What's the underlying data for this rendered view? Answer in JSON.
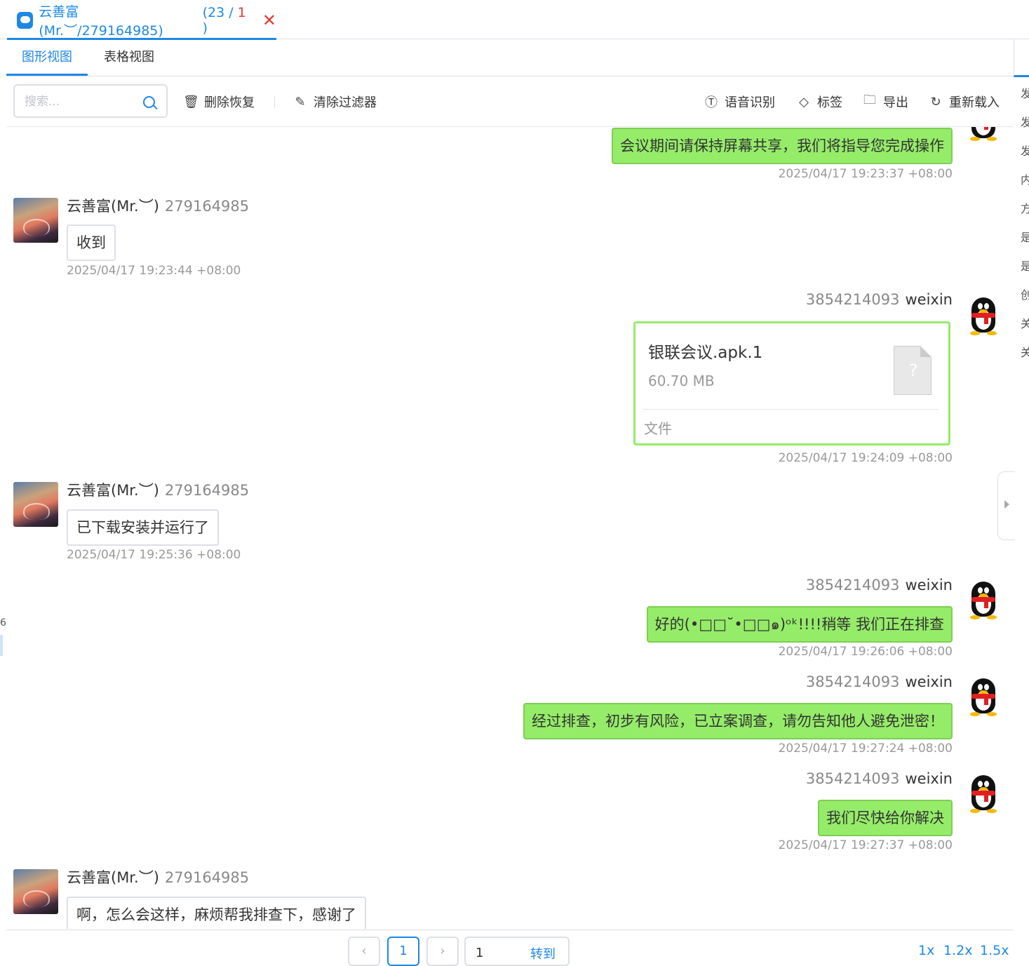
{
  "window_tab": {
    "title": "云善富(Mr.︶/279164985)",
    "count_prefix": "(23 / ",
    "count_red": "1",
    "count_suffix": " )",
    "close_icon": "close-icon"
  },
  "view_tabs": {
    "graph": "图形视图",
    "table": "表格视图"
  },
  "toolbar": {
    "search_placeholder": "搜索...",
    "delete_recover": "删除恢复",
    "clear_filter": "清除过滤器",
    "speech_recognition": "语音识别",
    "tag": "标签",
    "export": "导出",
    "reload": "重新载入"
  },
  "messages": [
    {
      "direction": "out",
      "text": "会议期间请保持屏幕共享，我们将指导您完成操作",
      "time": "2025/04/17 19:23:37 +08:00"
    },
    {
      "direction": "in",
      "sender_name": "云善富(Mr.︶)",
      "sender_id": "279164985",
      "text": "收到",
      "time": "2025/04/17 19:23:44 +08:00"
    },
    {
      "direction": "out",
      "sender_id": "3854214093",
      "sender_name": "weixin",
      "type": "file",
      "file_name": "银联会议.apk.1",
      "file_size": "60.70 MB",
      "file_type": "文件",
      "time": "2025/04/17 19:24:09 +08:00"
    },
    {
      "direction": "in",
      "sender_name": "云善富(Mr.︶)",
      "sender_id": "279164985",
      "text": "已下载安装并运行了",
      "time": "2025/04/17 19:25:36 +08:00"
    },
    {
      "direction": "out",
      "sender_id": "3854214093",
      "sender_name": "weixin",
      "text": "好的(•□□˘•□□๑)ᵒᵏ!!!!稍等 我们正在排查",
      "time": "2025/04/17 19:26:06 +08:00"
    },
    {
      "direction": "out",
      "sender_id": "3854214093",
      "sender_name": "weixin",
      "text": "经过排查，初步有风险，已立案调查，请勿告知他人避免泄密！",
      "time": "2025/04/17 19:27:24 +08:00"
    },
    {
      "direction": "out",
      "sender_id": "3854214093",
      "sender_name": "weixin",
      "text": "我们尽快给你解决",
      "time": "2025/04/17 19:27:37 +08:00"
    },
    {
      "direction": "in",
      "sender_name": "云善富(Mr.︶)",
      "sender_id": "279164985",
      "text": "啊，怎么会这样，麻烦帮我排查下，感谢了"
    }
  ],
  "right_edge_chars": [
    "发",
    "发",
    "发",
    "内",
    "方",
    "是",
    "是",
    "创",
    "关",
    "关"
  ],
  "left_edge_char": "6",
  "pager": {
    "prev": "‹",
    "current": "1",
    "next": "›",
    "goto_value": "1",
    "goto_label": "转到",
    "zoom": [
      "1x",
      "1.2x",
      "1.5x"
    ]
  },
  "colors": {
    "accent": "#1e88e5",
    "out_bubble": "#95ec69",
    "close": "#e53935"
  }
}
